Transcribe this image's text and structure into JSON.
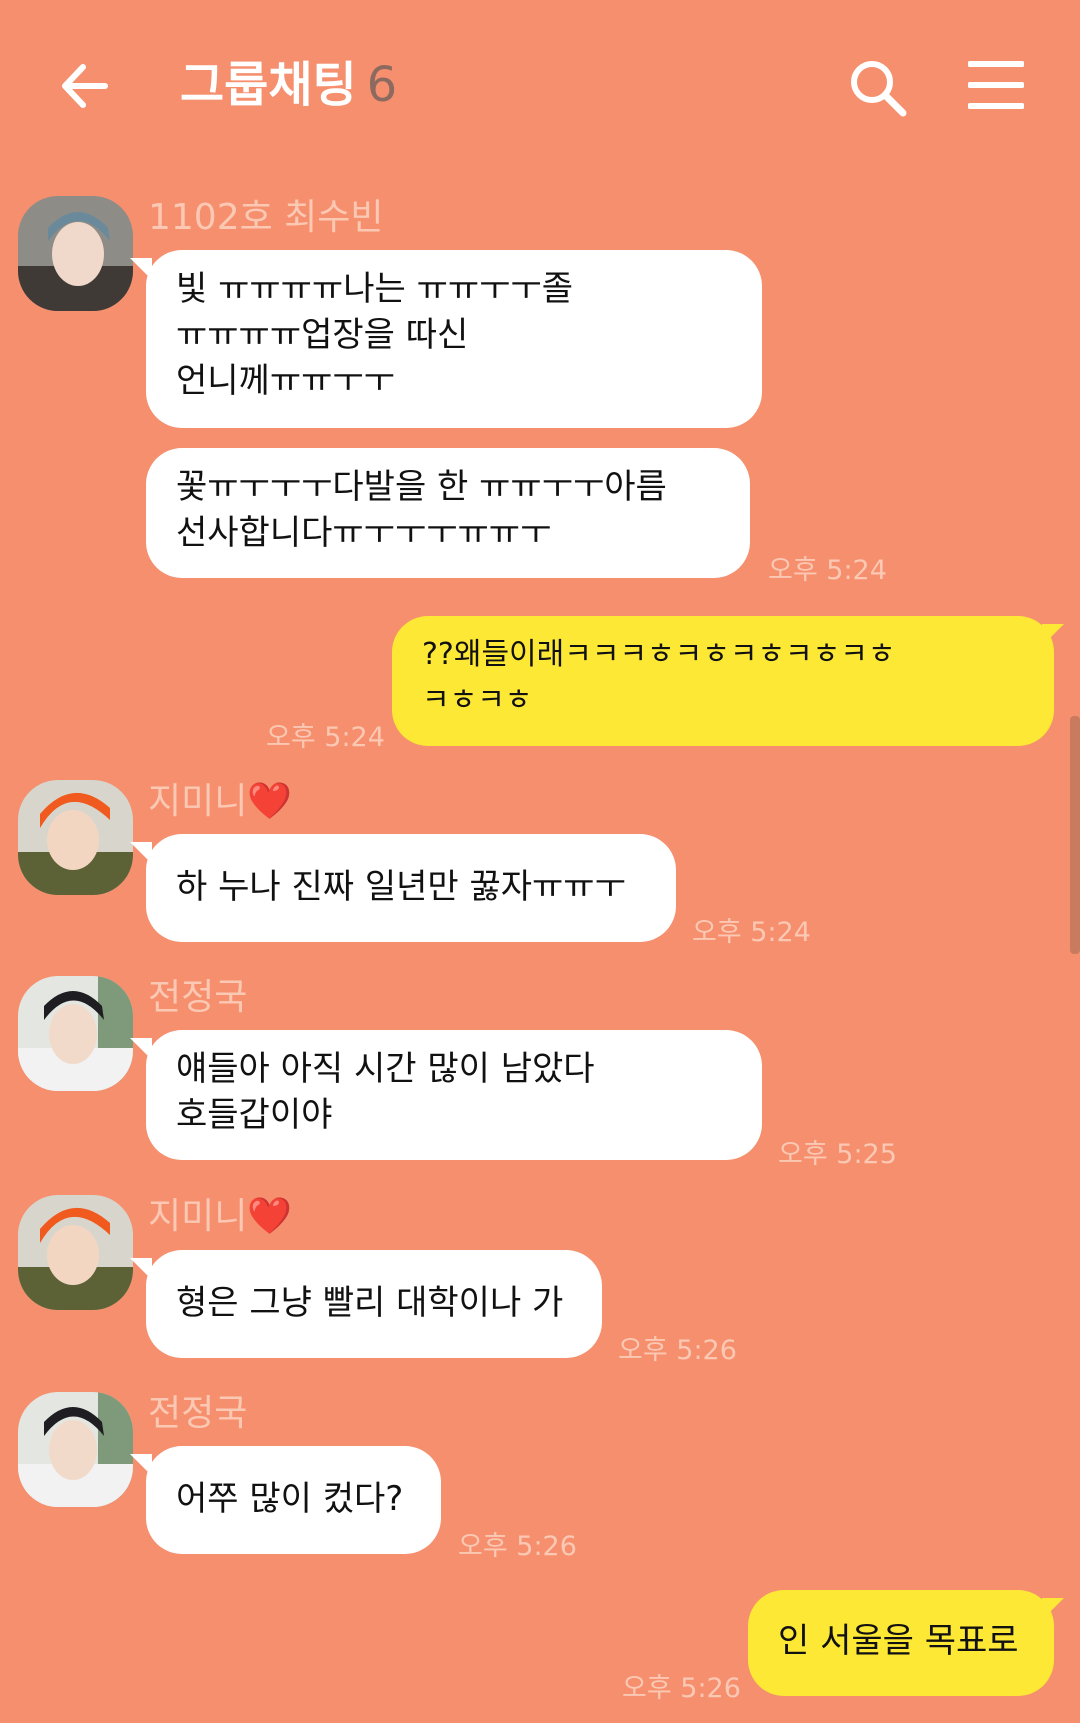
{
  "header": {
    "title": "그룹채팅",
    "member_count": "6",
    "back_icon": "back-arrow-icon",
    "search_icon": "search-icon",
    "menu_icon": "hamburger-menu-icon"
  },
  "colors": {
    "background": "#F58F6E",
    "other_bubble": "#FFFFFF",
    "my_bubble": "#FDE835",
    "meta_text": "#FBC8B4"
  },
  "messages": [
    {
      "sender": "1102호 최수빈",
      "line1": "빛 ㅠㅠㅠㅠ나는 ㅠㅠㅜㅜ졸",
      "line2": "ㅠㅠㅠㅠ업장을 따신",
      "line3": "언니께ㅠㅠㅜㅜ"
    },
    {
      "line1": "꽃ㅠㅜㅜㅜ다발을 한 ㅠㅠㅜㅜ아름",
      "line2": "선사합니다ㅠㅜㅜㅜㅠㅠㅜ",
      "time": "오후 5:24"
    },
    {
      "line1": "??왜들이래ㅋㅋㅋㅎㅋㅎㅋㅎㅋㅎㅋㅎ",
      "line2": "ㅋㅎㅋㅎ",
      "time": "오후 5:24"
    },
    {
      "sender": "지미니❤️",
      "line1": "하 누나 진짜 일년만 꿇자ㅠㅠㅜ",
      "time": "오후 5:24"
    },
    {
      "sender": "전정국",
      "line1": "얘들아 아직 시간 많이 남았다",
      "line2": "호들갑이야",
      "time": "오후 5:25"
    },
    {
      "sender": "지미니❤️",
      "line1": "형은 그냥 빨리 대학이나 가",
      "time": "오후 5:26"
    },
    {
      "sender": "전정국",
      "line1": "어쭈 많이 컸다?",
      "time": "오후 5:26"
    },
    {
      "line1": "인 서울을 목표로",
      "time": "오후 5:26"
    }
  ]
}
